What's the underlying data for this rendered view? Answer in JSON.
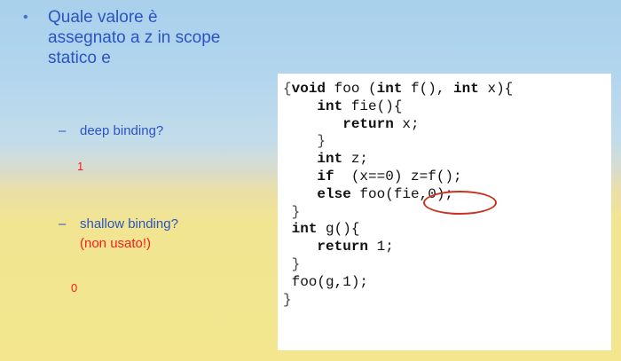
{
  "question": {
    "bullet": "•",
    "text": "Quale valore è assegnato a z in scope statico e"
  },
  "deep": {
    "dash": "–",
    "label": "deep binding?",
    "answer": "1"
  },
  "shallow": {
    "dash": "–",
    "label": "shallow binding?",
    "note_open": "(",
    "note_red": "non usato",
    "note_close": "!)",
    "answer": "0"
  },
  "code": {
    "l1": {
      "a": "{",
      "k1": "void",
      "b": " foo (",
      "k2": "int",
      "c": " f(), ",
      "k3": "int",
      "d": " x){"
    },
    "l2": {
      "a": "    ",
      "k1": "int",
      "b": " fie(){"
    },
    "l3": {
      "a": "       ",
      "k1": "return",
      "b": " x;"
    },
    "l4": {
      "a": "    }"
    },
    "l5": {
      "a": "    ",
      "k1": "int",
      "b": " z;"
    },
    "l6": {
      "a": "    ",
      "k1": "if",
      "b": "  (x==0) z=f();"
    },
    "l7": {
      "a": "    ",
      "k1": "else",
      "b": " foo(fie,0);"
    },
    "l8": {
      "a": " }"
    },
    "l9": {
      "a": " ",
      "k1": "int",
      "b": " g(){"
    },
    "l10": {
      "a": "    ",
      "k1": "return",
      "b": " 1;"
    },
    "l11": {
      "a": " }"
    },
    "l12": {
      "a": " foo(g,1);"
    },
    "l13": {
      "a": "}"
    }
  },
  "colors": {
    "title_blue": "#2b54c2",
    "answer_red": "#ff1a1a",
    "circle_red": "#c8321e"
  }
}
